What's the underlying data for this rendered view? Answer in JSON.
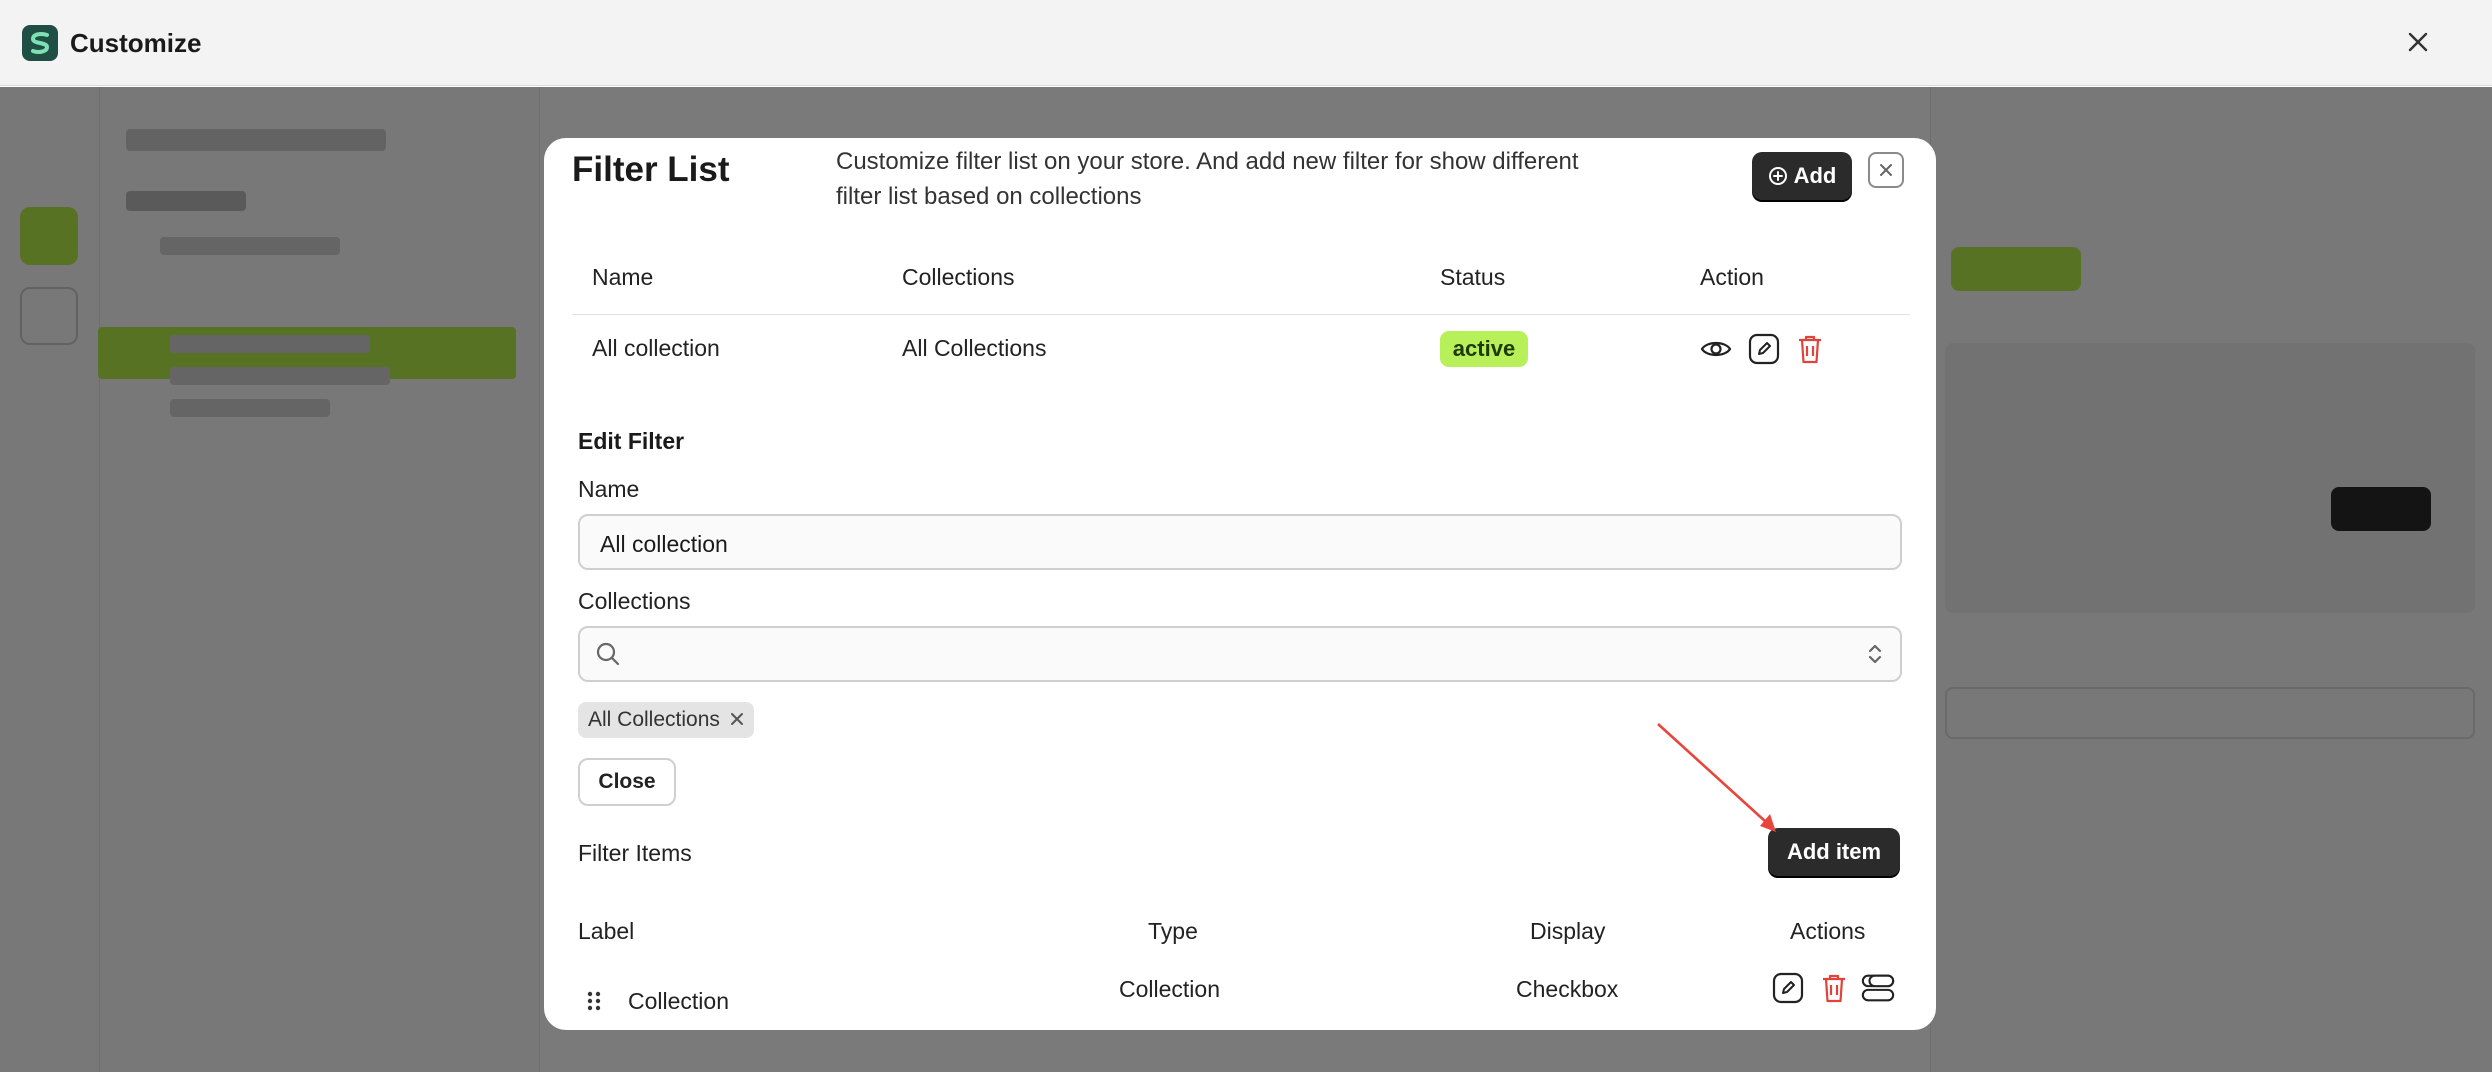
{
  "window": {
    "title": "Customize",
    "close_icon": "close-icon"
  },
  "modal": {
    "title": "Filter List",
    "description": "Customize filter list on your store. And add new filter for show different filter list based on collections",
    "add_button_label": "Add",
    "close_icon": "close-icon",
    "table": {
      "headers": [
        "Name",
        "Collections",
        "Status",
        "Action"
      ],
      "rows": [
        {
          "name": "All collection",
          "collections": "All Collections",
          "status": "active"
        }
      ],
      "row_actions": [
        "eye-icon",
        "edit-icon",
        "trash-icon"
      ]
    },
    "edit_filter": {
      "section_title": "Edit Filter",
      "name_label": "Name",
      "name_value": "All collection",
      "collections_label": "Collections",
      "collections_search_value": "",
      "selected_chip": "All Collections",
      "close_button_label": "Close"
    },
    "filter_items": {
      "title": "Filter Items",
      "add_item_button_label": "Add item",
      "headers": [
        "Label",
        "Type",
        "Display",
        "Actions"
      ],
      "rows": [
        {
          "label": "Collection",
          "type": "Collection",
          "display": "Checkbox"
        }
      ]
    }
  },
  "colors": {
    "accent_green": "#b7f058",
    "dark_button": "#2b2b2b",
    "delete_red": "#e0433a",
    "annotation_arrow": "#e8453c"
  }
}
